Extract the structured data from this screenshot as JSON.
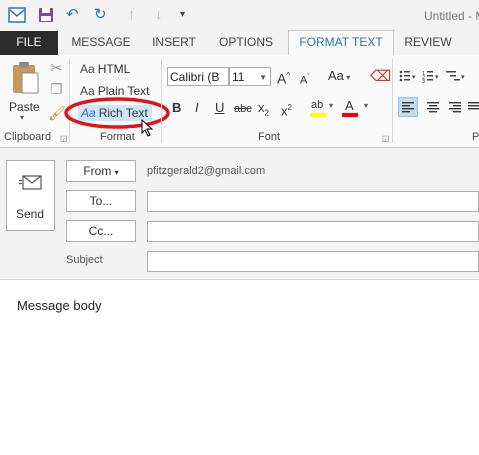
{
  "window": {
    "title": "Untitled - Message",
    "title_visible": "Untitled - M"
  },
  "quick_access": {
    "icons": [
      "outlook-icon",
      "save-icon",
      "undo-icon",
      "redo-icon",
      "up-arrow-icon",
      "down-arrow-icon",
      "customize-icon"
    ]
  },
  "tabs": [
    {
      "label": "FILE"
    },
    {
      "label": "MESSAGE"
    },
    {
      "label": "INSERT"
    },
    {
      "label": "OPTIONS"
    },
    {
      "label": "FORMAT TEXT"
    },
    {
      "label": "REVIEW"
    }
  ],
  "ribbon": {
    "clipboard": {
      "paste_label": "Paste",
      "group_label": "Clipboard"
    },
    "format": {
      "html_label": "HTML",
      "plain_label": "Plain Text",
      "rich_label": "Rich Text",
      "aa": "Aa",
      "group_label": "Format"
    },
    "font": {
      "font_name": "Calibri (B",
      "font_size": "11",
      "grow": "A",
      "shrink": "A",
      "change_case": "Aa",
      "bold": "B",
      "italic": "I",
      "underline": "U",
      "strike": "abc",
      "sub": "x",
      "sup": "x",
      "sub_mark": "2",
      "sup_mark": "2",
      "highlight": "ab",
      "font_color": "A",
      "group_label": "Font"
    },
    "paragraph": {
      "group_label": "P"
    }
  },
  "compose": {
    "send_label": "Send",
    "from_label": "From",
    "from_value": "pfitzgerald2@gmail.com",
    "to_label": "To...",
    "cc_label": "Cc...",
    "subject_label": "Subject"
  },
  "body": {
    "text": "Message body"
  },
  "colors": {
    "accent": "#2e75b6",
    "highlight_ring": "#e0131a",
    "highlight_yellow": "#ffff00",
    "font_red": "#ff0000"
  }
}
